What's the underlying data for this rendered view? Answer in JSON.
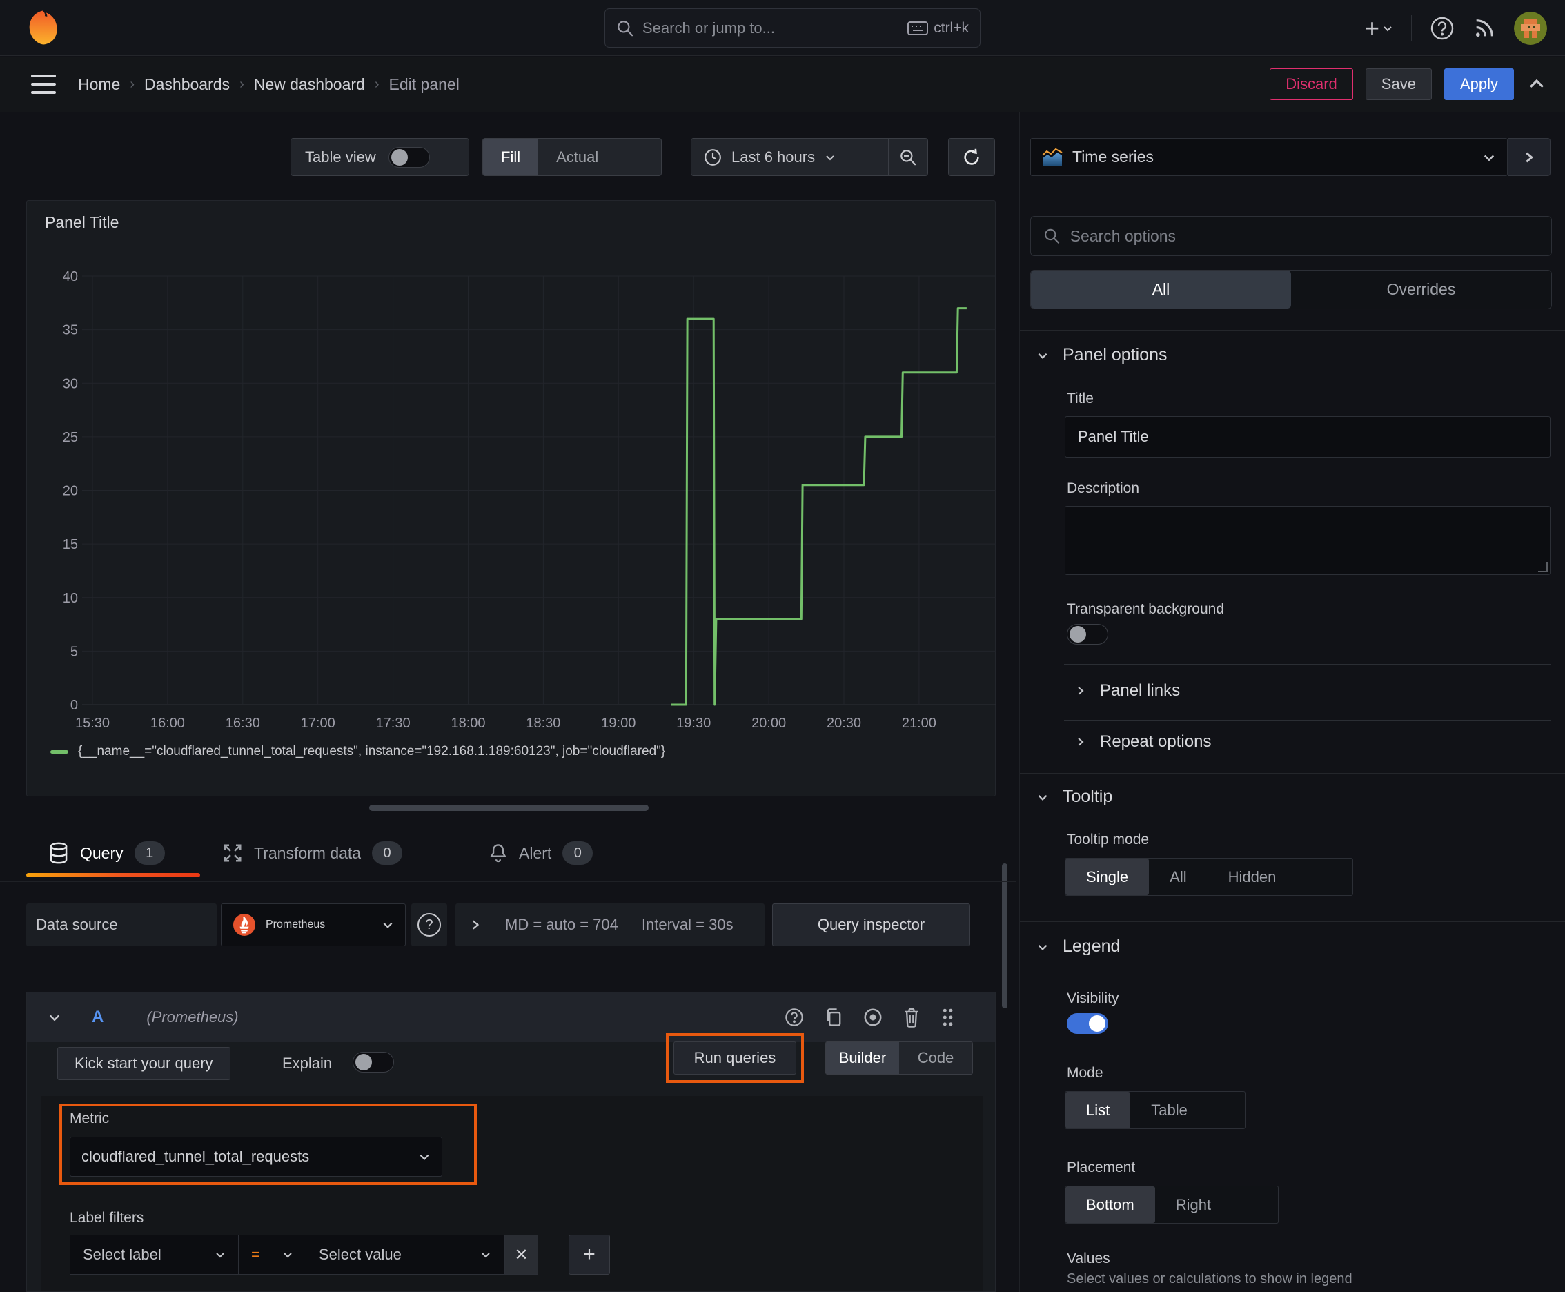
{
  "topnav": {
    "search_placeholder": "Search or jump to...",
    "search_shortcut": "ctrl+k"
  },
  "breadcrumb": {
    "items": [
      {
        "label": "Home"
      },
      {
        "label": "Dashboards"
      },
      {
        "label": "New dashboard"
      },
      {
        "label": "Edit panel"
      }
    ],
    "discard": "Discard",
    "save": "Save",
    "apply": "Apply"
  },
  "toolbar": {
    "table_view_label": "Table view",
    "table_view_on": false,
    "fill": "Fill",
    "actual": "Actual",
    "display_mode_selected": "Fill",
    "time_range": "Last 6 hours"
  },
  "panel": {
    "title": "Panel Title"
  },
  "chart_data": {
    "type": "line",
    "title": "Panel Title",
    "line_color": "#73bf69",
    "x_ticks": [
      "15:30",
      "16:00",
      "16:30",
      "17:00",
      "17:30",
      "18:00",
      "18:30",
      "19:00",
      "19:30",
      "20:00",
      "20:30",
      "21:00"
    ],
    "x_tick_interval_minutes": 30,
    "y_ticks": [
      0,
      5,
      10,
      15,
      20,
      25,
      30,
      35,
      40
    ],
    "ylim": [
      0,
      40
    ],
    "grid": true,
    "legend_position": "bottom",
    "series": [
      {
        "name": "{__name__=\"cloudflared_tunnel_total_requests\", instance=\"192.168.1.189:60123\", job=\"cloudflared\"}",
        "color": "#73bf69",
        "points_t_v": [
          [
            231,
            0
          ],
          [
            237,
            0
          ],
          [
            237.5,
            36
          ],
          [
            248,
            36
          ],
          [
            248.4,
            0
          ],
          [
            249,
            8
          ],
          [
            283,
            8
          ],
          [
            283.5,
            20.5
          ],
          [
            308,
            20.5
          ],
          [
            308.5,
            25
          ],
          [
            323,
            25
          ],
          [
            323.5,
            31
          ],
          [
            345,
            31
          ],
          [
            345.5,
            37
          ],
          [
            349,
            37
          ]
        ],
        "note_t_is_minutes_after_1530": true
      }
    ]
  },
  "tabs": {
    "query": "Query",
    "query_count": "1",
    "transform": "Transform data",
    "transform_count": "0",
    "alert": "Alert",
    "alert_count": "0",
    "active": "Query"
  },
  "datasource": {
    "label": "Data source",
    "name": "Prometheus",
    "options_md": "MD = auto = 704",
    "options_interval": "Interval = 30s",
    "query_inspector": "Query inspector"
  },
  "query_editor": {
    "ref_id": "A",
    "datasource_hint": "(Prometheus)",
    "kick_start": "Kick start your query",
    "explain": "Explain",
    "explain_on": false,
    "run_queries": "Run queries",
    "builder": "Builder",
    "code": "Code",
    "mode_selected": "Builder",
    "metric_label": "Metric",
    "metric_value": "cloudflared_tunnel_total_requests",
    "label_filters_label": "Label filters",
    "select_label_placeholder": "Select label",
    "operator": "=",
    "select_value_placeholder": "Select value"
  },
  "sidebar": {
    "visualization": "Time series",
    "search_placeholder": "Search options",
    "tab_all": "All",
    "tab_overrides": "Overrides",
    "selected_tab": "All",
    "panel_options": {
      "title": "Panel options",
      "title_label": "Title",
      "title_value": "Panel Title",
      "description_label": "Description",
      "description_value": "",
      "transparent_label": "Transparent background",
      "transparent_on": false
    },
    "panel_links": "Panel links",
    "repeat_options": "Repeat options",
    "tooltip": {
      "title": "Tooltip",
      "mode_label": "Tooltip mode",
      "options": [
        "Single",
        "All",
        "Hidden"
      ],
      "selected": "Single"
    },
    "legend": {
      "title": "Legend",
      "visibility_label": "Visibility",
      "visibility_on": true,
      "mode_label": "Mode",
      "mode_options": [
        "List",
        "Table"
      ],
      "mode_selected": "List",
      "placement_label": "Placement",
      "placement_options": [
        "Bottom",
        "Right"
      ],
      "placement_selected": "Bottom",
      "values_label": "Values",
      "values_hint": "Select values or calculations to show in legend"
    }
  },
  "colors": {
    "highlight_orange": "#e8590f",
    "apply_blue": "#3d71d9",
    "discard_pink": "#e02f6e",
    "series_green": "#73bf69",
    "active_tab_underline": "orange-red-gradient"
  }
}
